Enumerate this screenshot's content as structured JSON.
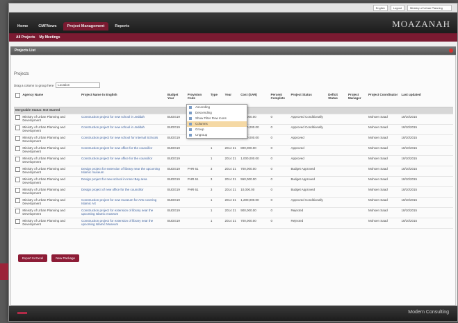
{
  "topbar": {
    "lang": "English",
    "workspace": "Logout",
    "selector": "Ministry of Urban Planning"
  },
  "nav": {
    "tabs": [
      "Home",
      "CMFNews",
      "Project Management",
      "Reports"
    ],
    "active_tab_index": 2,
    "brand": "MOAZANAH"
  },
  "subnav": {
    "items": [
      "All Projects",
      "My Meetings"
    ]
  },
  "panel": {
    "title": "Projects List",
    "section_title": "Projects"
  },
  "group_by": {
    "label": "Drag a column to group here",
    "value": "Location"
  },
  "table": {
    "columns": [
      "",
      "Agency Name",
      "Project Name in English",
      "Budget Year",
      "Provision Code",
      "Type",
      "Year",
      "Cost (SAR)",
      "Percent Complete",
      "Project Status",
      "Deficit Status",
      "Project Manager",
      "Project Coordinator",
      "Last updated"
    ],
    "group_label": "Mergeable Status: Not Started",
    "rows": [
      [
        "",
        "Ministry of Urban Planning and Development",
        "Construction project for new school in Jeddah",
        "BUDG19",
        "",
        "1",
        "2014 21",
        "800,000.00",
        "0",
        "Approved Conditionally",
        "",
        "",
        "Mohsen Saad",
        "18/10/2015"
      ],
      [
        "",
        "Ministry of Urban Planning and Development",
        "Construction project for new school in Jeddah",
        "BUDG19",
        "",
        "1",
        "2014 21",
        "1,000,000.00",
        "0",
        "Approved Conditionally",
        "",
        "",
        "Mohsen Saad",
        "18/10/2015"
      ],
      [
        "",
        "Ministry of Urban Planning and Development",
        "Construction project for new school for Internal Schools",
        "BUDG19",
        "",
        "1",
        "2014 21",
        "1,000,000.00",
        "0",
        "Approved",
        "",
        "",
        "Mohsen Saad",
        "18/10/2015"
      ],
      [
        "",
        "Ministry of Urban Planning and Development",
        "Construction project for new office for the councillor",
        "BUDG19",
        "",
        "1",
        "2014 21",
        "800,000.00",
        "0",
        "Approved",
        "",
        "",
        "Mohsen Saad",
        "18/10/2015"
      ],
      [
        "",
        "Ministry of Urban Planning and Development",
        "Construction project for new office for the councillor",
        "BUDG19",
        "",
        "1",
        "2014 21",
        "1,000,000.00",
        "0",
        "Approved",
        "",
        "",
        "Mohsen Saad",
        "18/10/2015"
      ],
      [
        "",
        "Ministry of Urban Planning and Development",
        "Design project for extension of library near the upcoming Islamic museum",
        "BUDG19",
        "PHR 61",
        "3",
        "2014 21",
        "700,000.00",
        "0",
        "Budget Approved",
        "",
        "",
        "Mohsen Saad",
        "18/10/2015"
      ],
      [
        "",
        "Ministry of Urban Planning and Development",
        "Design project for new school in Inner Bay area",
        "BUDG19",
        "PHR 61",
        "3",
        "2014 21",
        "550,000.00",
        "0",
        "Budget Approved",
        "",
        "",
        "Mohsen Saad",
        "18/10/2015"
      ],
      [
        "",
        "Ministry of Urban Planning and Development",
        "Design project of new office for the councillor",
        "BUDG19",
        "PHR 61",
        "3",
        "2014 21",
        "10,000.00",
        "0",
        "Budget Approved",
        "",
        "",
        "Mohsen Saad",
        "18/10/2015"
      ],
      [
        "",
        "Ministry of Urban Planning and Development",
        "Construction project for new museum for Arts covering Islamic Art",
        "BUDG19",
        "",
        "1",
        "2014 21",
        "1,200,000.00",
        "0",
        "Approved Conditionally",
        "",
        "",
        "Mohsen Saad",
        "18/10/2015"
      ],
      [
        "",
        "Ministry of Urban Planning and Development",
        "Construction project for extension of library near the upcoming Islamic museum",
        "BUDG19",
        "",
        "1",
        "2014 21",
        "900,000.00",
        "0",
        "Rejected",
        "",
        "",
        "Mohsen Saad",
        "18/10/2015"
      ],
      [
        "",
        "Ministry of Urban Planning and Development",
        "Construction project for extension of library near the upcoming Islamic Museum",
        "BUDG19",
        "",
        "1",
        "2014 21",
        "700,000.00",
        "0",
        "Rejected",
        "",
        "",
        "Mohsen Saad",
        "18/10/2015"
      ]
    ]
  },
  "context_menu": {
    "items": [
      "Ascending",
      "Descending",
      "Show Filter Row Icons",
      "Columns",
      "Group",
      "Ungroup"
    ],
    "selected_index": 3
  },
  "actions": {
    "export": "Export to Excel",
    "new": "New Package"
  },
  "footer": {
    "logo": "Modern Consulting"
  },
  "colors": {
    "brand": "#7a1a31",
    "nav": "#1c1c1c",
    "link": "#3b5f9c"
  }
}
